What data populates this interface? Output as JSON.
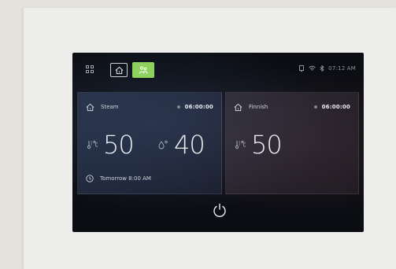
{
  "status_bar": {
    "time": "07:12 AM"
  },
  "tabs": [
    {
      "icon": "home-icon",
      "active": false
    },
    {
      "icon": "people-icon",
      "active": true
    }
  ],
  "saunas": [
    {
      "name": "Steam",
      "timer": "06:00:00",
      "temperature": "50",
      "humidity": "40",
      "schedule": "Tomorrow 8:00 AM"
    },
    {
      "name": "Finnish",
      "timer": "06:00:00",
      "temperature": "50"
    }
  ],
  "colors": {
    "accent": "#8fd15e",
    "screen_bg": "#0b0d12"
  }
}
